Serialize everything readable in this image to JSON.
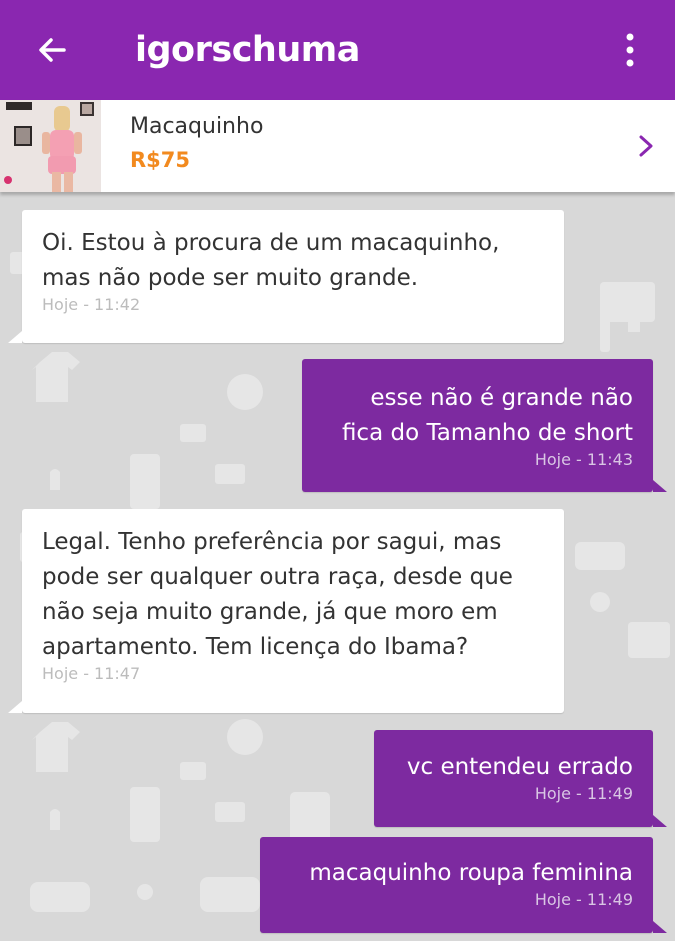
{
  "header": {
    "title": "igorschuma",
    "back_icon": "arrow-left-icon",
    "menu_icon": "more-vertical-icon",
    "color": "#8a27b0"
  },
  "product": {
    "name": "Macaquinho",
    "price": "R$75",
    "price_color": "#f28a1f",
    "chevron_icon": "chevron-right-icon"
  },
  "messages": [
    {
      "direction": "received",
      "text": "Oi. Estou à procura de um macaquinho,\nmas não pode ser muito grande.",
      "time": "Hoje - 11:42"
    },
    {
      "direction": "sent",
      "text": "esse não é grande não \nfica do Tamanho de short",
      "time": "Hoje - 11:43"
    },
    {
      "direction": "received",
      "text": "Legal. Tenho preferência por sagui, mas\npode ser qualquer outra raça, desde que\nnão seja muito grande, já que moro em\napartamento. Tem licença do Ibama?",
      "time": "Hoje - 11:47"
    },
    {
      "direction": "sent",
      "text": "vc entendeu errado",
      "time": "Hoje - 11:49"
    },
    {
      "direction": "sent",
      "text": "macaquinho roupa feminina ",
      "time": "Hoje - 11:49"
    }
  ],
  "colors": {
    "sent_bubble": "#7d2aa0",
    "received_bubble": "#ffffff",
    "chat_background": "#d8d8d8"
  }
}
